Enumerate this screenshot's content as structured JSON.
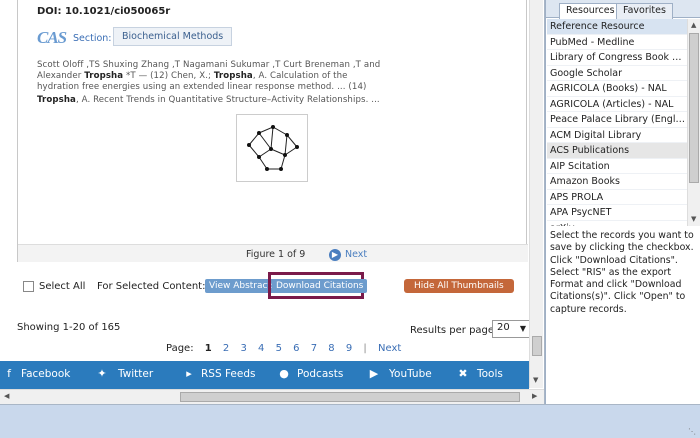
{
  "record": {
    "doi": "DOI: 10.1021/ci050065r",
    "acs_logo": "CAS",
    "section_label": "Section:",
    "section_value": "Biochemical Methods",
    "cite_line1": "Scott Oloff ,TS Shuxing Zhang ,T Nagamani Sukumar ,T Curt Breneman ,T and",
    "cite_line2a": "Alexander ",
    "cite_line2b": "Tropsha",
    "cite_line2c": " *T — (12) Chen, X.; ",
    "cite_line2d": "Tropsha",
    "cite_line2e": ", A. Calculation of the",
    "cite_line3": "hydration free energies using an extended linear response method. ... (14)",
    "cite_line4a": "Tropsha",
    "cite_line4b": ", A. Recent Trends in Quantitative Structure–Activity Relationships. ..."
  },
  "figure": {
    "counter": "Figure 1 of 9",
    "next_label": "Next"
  },
  "actions": {
    "select_all": "Select All",
    "for_selected": "For Selected Content:",
    "view_abstracts": "View Abstracts",
    "download_citations": "Download Citations",
    "hide_thumbnails": "Hide All Thumbnails"
  },
  "results": {
    "showing": "Showing 1-20 of 165",
    "per_page_label": "Results per page:",
    "per_page_value": "20"
  },
  "pager": {
    "label": "Page:",
    "current": "1",
    "pages": [
      "2",
      "3",
      "4",
      "5",
      "6",
      "7",
      "8",
      "9"
    ],
    "separator": "|",
    "next": "Next"
  },
  "social": {
    "facebook": "Facebook",
    "twitter": "Twitter",
    "rss": "RSS Feeds",
    "podcasts": "Podcasts",
    "youtube": "YouTube",
    "tools": "Tools"
  },
  "panel": {
    "tab_resources": "Resources",
    "tab_favorites": "Favorites",
    "resources": [
      "Reference Resource",
      "PubMed - Medline",
      "Library of Congress Book Catalog",
      "Google Scholar",
      "AGRICOLA (Books) - NAL",
      "AGRICOLA (Articles) - NAL",
      "Peace Palace Library (English)",
      "ACM Digital Library",
      "ACS Publications",
      "AIP Scitation",
      "Amazon Books",
      "APS PROLA",
      "APA PsycNET",
      "arXiv"
    ],
    "instructions": "Select the records you want to save by clicking the checkbox. Click \"Download Citations\". Select \"RIS\" as the export Format and click \"Download Citations(s)\". Click \"Open\" to capture records."
  },
  "colors": {
    "social_bar": "#2b7bbd",
    "link_blue": "#3a6eb5",
    "download_highlight": "#7a1a4a",
    "hide_button": "#c4673a",
    "list_header": "#d7e3f1"
  }
}
